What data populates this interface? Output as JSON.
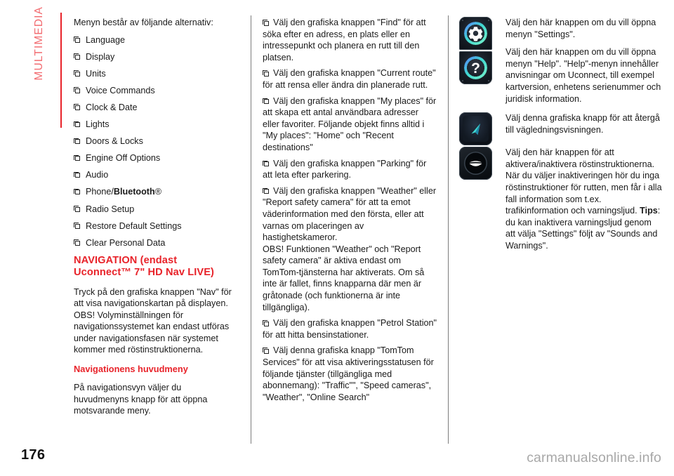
{
  "chapter": {
    "label": "MULTIMEDIA"
  },
  "colors": {
    "accent_red": "#e8232a",
    "chapter_tab": "#f26b70",
    "body_text": "#1a1a1a",
    "watermark": "#a8a8a8",
    "icon_ring_cyan": "#3fd8d0"
  },
  "column_1": {
    "intro": "Menyn består av följande alternativ:",
    "menu_items": [
      {
        "label": "Language"
      },
      {
        "label": "Display"
      },
      {
        "label": "Units"
      },
      {
        "label": "Voice Commands"
      },
      {
        "label": "Clock & Date"
      },
      {
        "label": "Lights"
      },
      {
        "label": "Doors & Locks"
      },
      {
        "label": "Engine Off Options"
      },
      {
        "label": "Audio"
      },
      {
        "label": "Phone/",
        "label_bold": "Bluetooth",
        "label_after": "®"
      },
      {
        "label": "Radio Setup"
      },
      {
        "label": "Restore Default Settings"
      },
      {
        "label": "Clear Personal Data"
      }
    ],
    "heading_navigation": "NAVIGATION (endast Uconnect™ 7\" HD Nav LIVE)",
    "para_nav_1": "Tryck på den grafiska knappen \"Nav\" för att visa navigationskartan på displayen.",
    "para_nav_2": "OBS! Volyminställningen för navigationssystemet kan endast utföras under navigationsfasen när systemet kommer med röstinstruktionerna.",
    "heading_main_menu": "Navigationens huvudmeny",
    "para_main_menu": "På navigationsvyn väljer du huvudmenyns knapp för att öppna motsvarande meny."
  },
  "column_2": {
    "bullets": [
      "Välj den grafiska knappen \"Find\" för att söka efter en adress, en plats eller en intressepunkt och planera en rutt till den platsen.",
      "Välj den grafiska knappen \"Current route\" för att rensa eller ändra din planerade rutt.",
      "Välj den grafiska knappen \"My places\" för att skapa ett antal användbara adresser eller favoriter. Följande objekt finns alltid i \"My places\": \"Home\" och \"Recent destinations\"",
      "Välj den grafiska knappen \"Parking\" för att leta efter parkering.",
      "Välj den grafiska knappen \"Weather\" eller \"Report safety camera\" för att ta emot väderinformation med den första, eller att varnas om placeringen av hastighetskameror.",
      "Välj den grafiska knappen \"Petrol Station\" för att hitta bensinstationer.",
      "Välj denna grafiska knapp \"TomTom Services\" för att visa aktiveringsstatusen för följande tjänster (tillgängliga med abonnemang): \"Traffic\"\", \"Speed cameras\", \"Weather\", \"Online Search\""
    ],
    "note_weather": "OBS! Funktionen \"Weather\" och \"Report safety camera\" är aktiva endast om TomTom-tjänsterna har aktiverats. Om så inte är fallet, finns knapparna där men är gråtonade (och funktionerna är inte tillgängliga)."
  },
  "column_3": {
    "entries": [
      {
        "icon": "gear-icon",
        "text": "Välj den här knappen om du vill öppna menyn \"Settings\"."
      },
      {
        "icon": "question-mark-icon",
        "text": "Välj den här knappen om du vill öppna menyn \"Help\". \"Help\"-menyn innehåller anvisningar om Uconnect, till exempel kartversion, enhetens serienummer och juridisk information."
      },
      {
        "icon": "navigation-arrow-icon",
        "text": "Välj denna grafiska knapp för att återgå till vägledningsvisningen."
      },
      {
        "icon": "mouth-voice-icon",
        "text_part_1": "Välj den här knappen för att aktivera/inaktivera röstinstruktionerna. När du väljer inaktiveringen hör du inga röstinstruktioner för rutten, men får i alla fall information som t.ex. trafikinformation och varningsljud. ",
        "text_bold": "Tips",
        "text_part_2": ": du kan inaktivera varningsljud genom att välja \"Settings\" följt av \"Sounds and Warnings\"."
      }
    ]
  },
  "footer": {
    "page_number": "176",
    "watermark": "carmanualsonline.info"
  }
}
